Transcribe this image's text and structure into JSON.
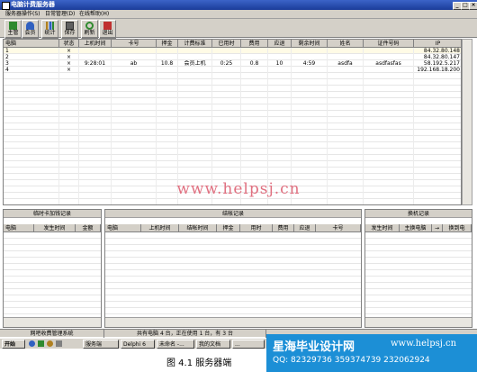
{
  "window": {
    "title": "电脑计费服务器",
    "minimize": "_",
    "maximize": "□",
    "close": "×"
  },
  "menu": [
    "服务器操作(S)",
    "日常管理(D)",
    "在线帮助(H)"
  ],
  "toolbar": [
    {
      "label": "主管",
      "icon": "manager-icon",
      "color": "#2f8a2f"
    },
    {
      "label": "会员",
      "icon": "member-icon",
      "color": "#3060c0"
    },
    {
      "label": "统计",
      "icon": "statistics-icon",
      "color": "#b08020"
    },
    {
      "label": "保存",
      "icon": "save-icon",
      "color": "#606060"
    },
    {
      "label": "刷新",
      "icon": "refresh-icon",
      "color": "#2f8a2f"
    },
    {
      "label": "退出",
      "icon": "exit-icon",
      "color": "#c03030"
    }
  ],
  "main_grid": {
    "columns": [
      "电脑",
      "状态",
      "上机时间",
      "卡号",
      "押金",
      "计费标准",
      "已用时",
      "费用",
      "应退",
      "剩余时间",
      "姓名",
      "证件号码",
      "IP"
    ],
    "rows": [
      [
        "1",
        "×",
        "",
        "",
        "",
        "",
        "",
        "",
        "",
        "",
        "",
        "",
        "84.32.80.148"
      ],
      [
        "2",
        "×",
        "",
        "",
        "",
        "",
        "",
        "",
        "",
        "",
        "",
        "",
        "84.32.80.147"
      ],
      [
        "3",
        "×",
        "9:28:01",
        "ab",
        "10.8",
        "会员上机",
        "0:25",
        "0.8",
        "10",
        "4:59",
        "asdfa",
        "asdfasfas",
        "58.192.5.217"
      ],
      [
        "4",
        "×",
        "",
        "",
        "",
        "",
        "",
        "",
        "",
        "",
        "",
        "",
        "192.168.18.200"
      ]
    ]
  },
  "watermark": "www.helpsj.cn",
  "panel_left": {
    "title": "临时卡加钱记录",
    "columns": [
      "电脑",
      "发生时间",
      "金额"
    ]
  },
  "panel_mid": {
    "title": "结帐记录",
    "columns": [
      "电脑",
      "上机时间",
      "结帐时间",
      "押金",
      "用时",
      "费用",
      "应退",
      "卡号"
    ]
  },
  "panel_right": {
    "title": "换机记录",
    "columns": [
      "发生时间",
      "主换电脑",
      "→",
      "换到电"
    ]
  },
  "status": {
    "left": "网吧收费管理系统",
    "mid": "共有电脑 4 台，正在使用 1 台，有 3 台"
  },
  "taskbar": {
    "start": "开始",
    "items": [
      "服务端",
      "Delphi 6",
      "未命名 -...",
      "我的文档",
      "..."
    ]
  },
  "brand": {
    "name": "星海毕业设计网",
    "url": "www.helpsj.cn",
    "qq": "QQ: 82329736  359374739  232062924"
  },
  "caption": "图 4.1   服务器端"
}
